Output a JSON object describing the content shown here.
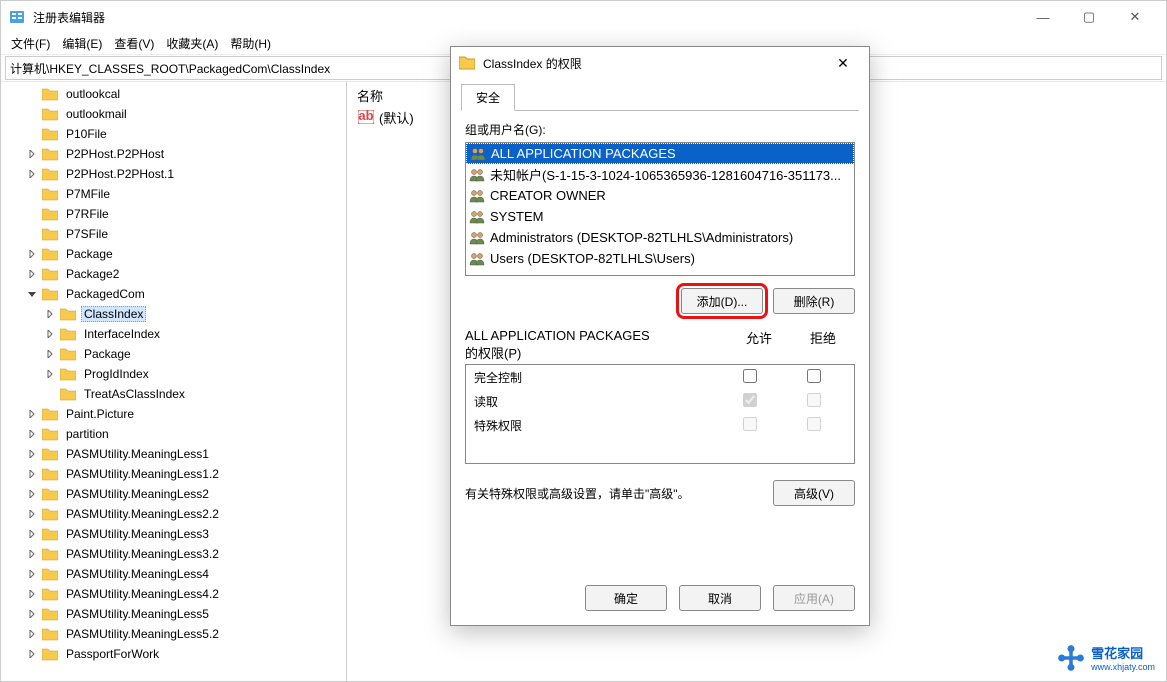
{
  "app": {
    "title": "注册表编辑器",
    "win_min": "—",
    "win_max": "▢",
    "win_close": "✕"
  },
  "menu": {
    "file": "文件(F)",
    "edit": "编辑(E)",
    "view": "查看(V)",
    "favorites": "收藏夹(A)",
    "help": "帮助(H)"
  },
  "address": "计算机\\HKEY_CLASSES_ROOT\\PackagedCom\\ClassIndex",
  "tree": [
    {
      "level": 1,
      "chev": "",
      "label": "outlookcal"
    },
    {
      "level": 1,
      "chev": "",
      "label": "outlookmail"
    },
    {
      "level": 1,
      "chev": "",
      "label": "P10File"
    },
    {
      "level": 1,
      "chev": ">",
      "label": "P2PHost.P2PHost"
    },
    {
      "level": 1,
      "chev": ">",
      "label": "P2PHost.P2PHost.1"
    },
    {
      "level": 1,
      "chev": "",
      "label": "P7MFile"
    },
    {
      "level": 1,
      "chev": "",
      "label": "P7RFile"
    },
    {
      "level": 1,
      "chev": "",
      "label": "P7SFile"
    },
    {
      "level": 1,
      "chev": ">",
      "label": "Package"
    },
    {
      "level": 1,
      "chev": ">",
      "label": "Package2"
    },
    {
      "level": 1,
      "chev": "v",
      "label": "PackagedCom",
      "open": true
    },
    {
      "level": 2,
      "chev": ">",
      "label": "ClassIndex",
      "selected": true
    },
    {
      "level": 2,
      "chev": ">",
      "label": "InterfaceIndex"
    },
    {
      "level": 2,
      "chev": ">",
      "label": "Package"
    },
    {
      "level": 2,
      "chev": ">",
      "label": "ProgIdIndex"
    },
    {
      "level": 2,
      "chev": "",
      "label": "TreatAsClassIndex"
    },
    {
      "level": 1,
      "chev": ">",
      "label": "Paint.Picture"
    },
    {
      "level": 1,
      "chev": ">",
      "label": "partition"
    },
    {
      "level": 1,
      "chev": ">",
      "label": "PASMUtility.MeaningLess1"
    },
    {
      "level": 1,
      "chev": ">",
      "label": "PASMUtility.MeaningLess1.2"
    },
    {
      "level": 1,
      "chev": ">",
      "label": "PASMUtility.MeaningLess2"
    },
    {
      "level": 1,
      "chev": ">",
      "label": "PASMUtility.MeaningLess2.2"
    },
    {
      "level": 1,
      "chev": ">",
      "label": "PASMUtility.MeaningLess3"
    },
    {
      "level": 1,
      "chev": ">",
      "label": "PASMUtility.MeaningLess3.2"
    },
    {
      "level": 1,
      "chev": ">",
      "label": "PASMUtility.MeaningLess4"
    },
    {
      "level": 1,
      "chev": ">",
      "label": "PASMUtility.MeaningLess4.2"
    },
    {
      "level": 1,
      "chev": ">",
      "label": "PASMUtility.MeaningLess5"
    },
    {
      "level": 1,
      "chev": ">",
      "label": "PASMUtility.MeaningLess5.2"
    },
    {
      "level": 1,
      "chev": ">",
      "label": "PassportForWork"
    }
  ],
  "values": {
    "col_name": "名称",
    "default_name": "(默认)"
  },
  "dialog": {
    "title": "ClassIndex 的权限",
    "tab_security": "安全",
    "groups_label": "组或用户名(G):",
    "users": [
      {
        "icon": "group",
        "label": "ALL APPLICATION PACKAGES",
        "selected": true
      },
      {
        "icon": "group",
        "label": "未知帐户(S-1-15-3-1024-1065365936-1281604716-351173...",
        "selected": false
      },
      {
        "icon": "group",
        "label": "CREATOR OWNER",
        "selected": false
      },
      {
        "icon": "group",
        "label": "SYSTEM",
        "selected": false
      },
      {
        "icon": "group",
        "label": "Administrators (DESKTOP-82TLHLS\\Administrators)",
        "selected": false
      },
      {
        "icon": "group",
        "label": "Users (DESKTOP-82TLHLS\\Users)",
        "selected": false
      }
    ],
    "add_btn": "添加(D)...",
    "remove_btn": "删除(R)",
    "perm_for_label_1": "ALL APPLICATION PACKAGES",
    "perm_for_label_2": "的权限(P)",
    "col_allow": "允许",
    "col_deny": "拒绝",
    "perms": [
      {
        "name": "完全控制",
        "allow": false,
        "deny": false,
        "disabled": false
      },
      {
        "name": "读取",
        "allow": true,
        "deny": false,
        "disabled": true
      },
      {
        "name": "特殊权限",
        "allow": false,
        "deny": false,
        "disabled": true
      }
    ],
    "adv_text": "有关特殊权限或高级设置，请单击\"高级\"。",
    "adv_btn": "高级(V)",
    "ok_btn": "确定",
    "cancel_btn": "取消",
    "apply_btn": "应用(A)"
  },
  "watermark": {
    "text": "雪花家园",
    "url": "www.xhjaty.com"
  }
}
